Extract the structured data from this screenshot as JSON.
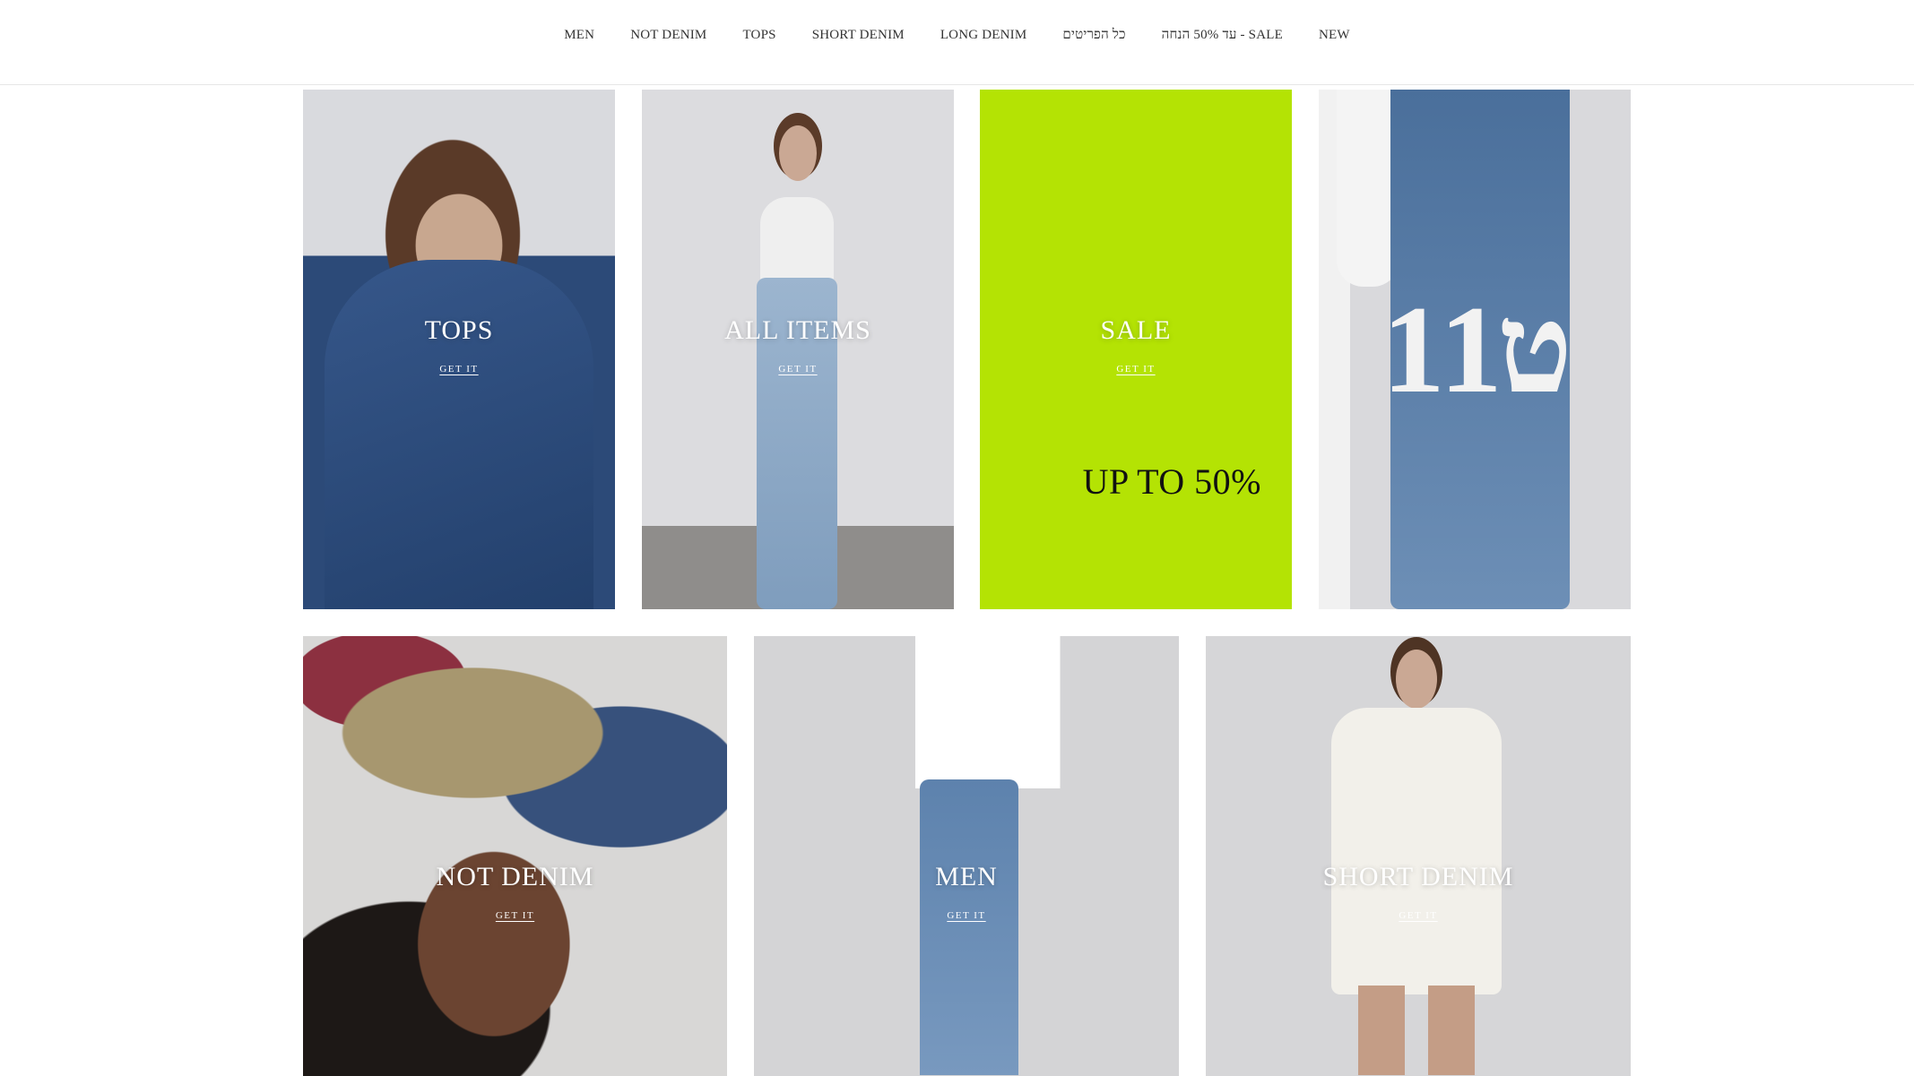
{
  "nav": {
    "items": [
      "MEN",
      "NOT DENIM",
      "TOPS",
      "SHORT DENIM",
      "LONG DENIM",
      "כל הפריטים",
      "SALE - עד 50% הנחה",
      "NEW"
    ]
  },
  "tiles": [
    {
      "label": "TOPS",
      "cta": "GET IT"
    },
    {
      "label": "ALL ITEMS",
      "cta": "GET IT"
    },
    {
      "label": "SALE",
      "cta": "GET IT",
      "promo": "UP TO 50%"
    },
    {
      "logo": "1ט1"
    },
    {
      "label": "NOT DENIM",
      "cta": "GET IT"
    },
    {
      "label": "MEN",
      "cta": "GET IT"
    },
    {
      "label": "SHORT DENIM",
      "cta": "GET IT"
    }
  ],
  "colors": {
    "sale_background": "#b4e304"
  }
}
